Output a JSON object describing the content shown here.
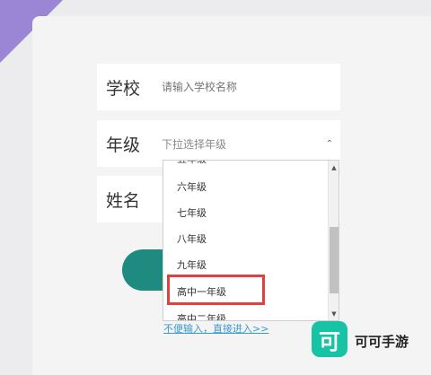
{
  "form": {
    "school": {
      "label": "学校",
      "placeholder": "请输入学校名称"
    },
    "grade": {
      "label": "年级",
      "placeholder": "下拉选择年级"
    },
    "name": {
      "label": "姓名"
    }
  },
  "dropdown": {
    "options": [
      "六年级",
      "七年级",
      "八年级",
      "九年级",
      "高中一年级",
      "高中二年级"
    ],
    "highlighted": "高中一年级"
  },
  "skip_link": "不便输入，直接进入>>",
  "watermark": {
    "text": "可可手游",
    "logo_glyph": "可"
  },
  "colors": {
    "accent": "#1e8a80",
    "highlight": "#e1413c",
    "link": "#3c9ac7",
    "logo": "#16c3a4",
    "corner": "#9a86d4"
  }
}
